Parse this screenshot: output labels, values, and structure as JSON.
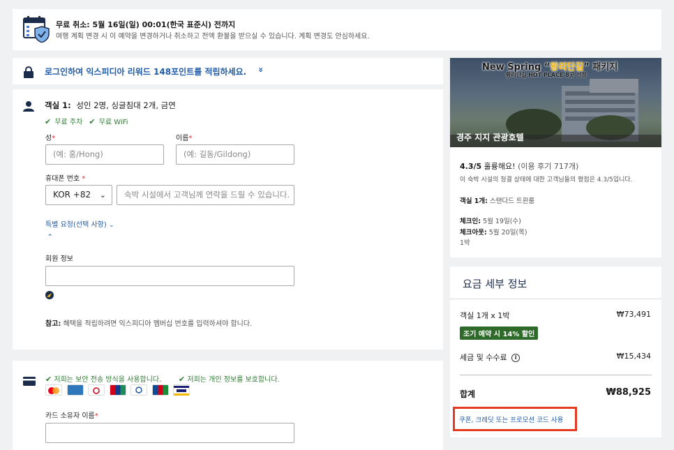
{
  "cancel_banner": {
    "title": "무료 취소: 5월 16일(일) 00:01(한국 표준시) 전까지",
    "subtitle": "여행 계획 변경 시 이 예약을 변경하거나 취소하고 전액 환불을 받으실 수 있습니다. 계획 변경도 안심하세요."
  },
  "login_banner": {
    "text": "로그인하여 익스피디아 리워드 148포인트를 적립하세요.",
    "chevron": "»"
  },
  "guest": {
    "room_label": "객실 1:",
    "room_desc": "성인 2명, 싱글침대 2개, 금연",
    "amenities": [
      "무료 주차",
      "무료 WiFi"
    ],
    "last_name_label": "성",
    "last_name_placeholder": "(예: 홍/Hong)",
    "first_name_label": "이름",
    "first_name_placeholder": "(예: 길동/Gildong)",
    "phone_label": "휴대폰 번호",
    "country_code": "KOR +82",
    "phone_placeholder": "숙박 시설에서 고객님께 연락을 드릴 수 있습니다.",
    "special_request": "특별 요청(선택 사항)",
    "member_label": "회원 정보",
    "note_label": "참고:",
    "note_text": "혜택을 적립하려면 익스피디아 멤버십 번호를 입력하셔야 합니다."
  },
  "payment": {
    "secure_1": "저희는 보안 전송 방식을 사용합니다.",
    "secure_2": "저희는 개인 정보를 보호합니다.",
    "cards": [
      "MC",
      "AMEX",
      "BC",
      "UP",
      "Diners",
      "JCB",
      "VISA"
    ],
    "cardholder_label": "카드 소유자 이름"
  },
  "hotel": {
    "ad_line1_a": "New Spring “",
    "ad_line1_b": "왕리단길",
    "ad_line1_c": "” 패키지",
    "ad_line2": "황리단길 HOT PLACE 8곳 선정",
    "name": "경주 지지 관광호텔",
    "rating": "4.3/5",
    "rating_word": "훌륭해요!",
    "reviews": "(이용 후기 717개)",
    "rating_desc": "이 숙박 시설의 청결 상태에 대한 고객님들의 평점은 4.3/5입니다.",
    "room_label": "객실 1개:",
    "room_type": "스탠다드 트윈룸",
    "checkin_label": "체크인:",
    "checkin": "5월 19일(수)",
    "checkout_label": "체크아웃:",
    "checkout": "5월 20일(목)",
    "nights": "1박"
  },
  "price": {
    "title": "요금 세부 정보",
    "room_line": "객실 1개 x 1박",
    "room_amount": "₩73,491",
    "discount_badge": "조기 예약 시 14% 할인",
    "tax_label": "세금 및 수수료",
    "tax_amount": "₩15,434",
    "total_label": "합계",
    "total_amount": "₩88,925",
    "coupon": "쿠폰, 크레딧 또는 프로모션 코드 사용"
  },
  "colors": {
    "accent_blue": "#1f5ba6",
    "brand_navy": "#1b2b4b",
    "success_green": "#2e7d32",
    "highlight_red": "#e53a22"
  }
}
